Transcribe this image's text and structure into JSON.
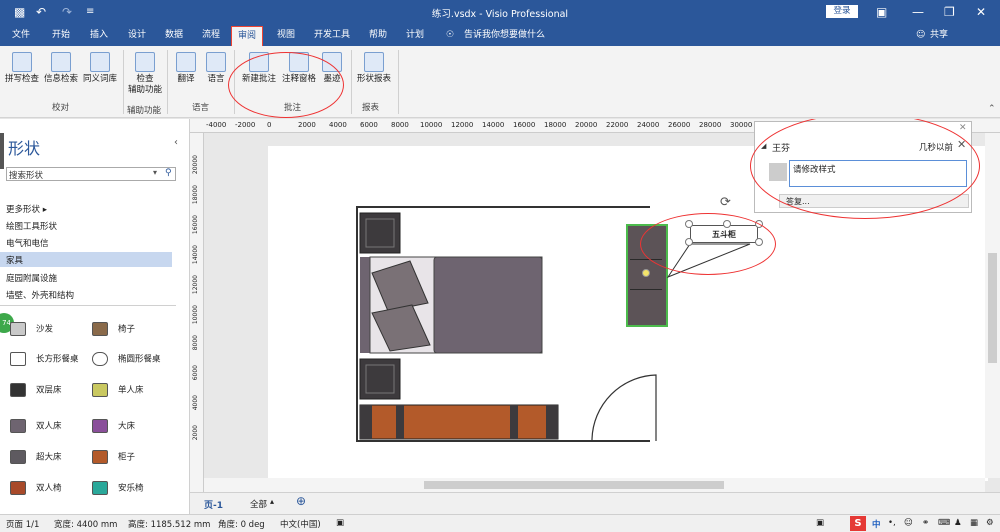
{
  "app": {
    "title": "练习.vsdx - Visio Professional",
    "login": "登录"
  },
  "menu": {
    "items": [
      "文件",
      "开始",
      "插入",
      "设计",
      "数据",
      "流程",
      "审阅",
      "视图",
      "开发工具",
      "帮助",
      "计划"
    ],
    "tell_me": "告诉我你想要做什么",
    "share": "共享"
  },
  "ribbon": {
    "proofing": {
      "spell": "拼写检查",
      "research": "信息检索",
      "thesaurus": "同义词库",
      "group": "校对"
    },
    "accessibility": {
      "check": "检查\n辅助功能",
      "group": "辅助功能"
    },
    "language": {
      "translate": "翻译",
      "lang": "语言",
      "group": "语言"
    },
    "comments": {
      "new": "新建批注",
      "pane": "注释窗格",
      "ink": "墨迹",
      "group": "批注"
    },
    "reports": {
      "shape_reports": "形状报表",
      "group": "报表"
    }
  },
  "shapes_panel": {
    "title": "形状",
    "search_placeholder": "搜索形状",
    "more": "更多形状",
    "categories": [
      "绘图工具形状",
      "电气和电信",
      "家具",
      "庭园附属设施",
      "墙壁、外壳和结构"
    ],
    "active_category": "家具",
    "badge": "74",
    "items": [
      "沙发",
      "椅子",
      "长方形餐桌",
      "椭圆形餐桌",
      "双层床",
      "单人床",
      "双人床",
      "大床",
      "超大床",
      "柜子",
      "双人椅",
      "安乐椅"
    ]
  },
  "ruler": {
    "h": [
      "-4000",
      "-2000",
      "0",
      "2000",
      "4000",
      "6000",
      "8000",
      "10000",
      "12000",
      "14000",
      "16000",
      "18000",
      "20000",
      "22000",
      "24000",
      "26000",
      "28000",
      "30000"
    ],
    "v": [
      "20000",
      "18000",
      "16000",
      "14000",
      "12000",
      "10000",
      "8000",
      "6000",
      "4000",
      "2000"
    ]
  },
  "drawing": {
    "callout_text": "五斗柜"
  },
  "comment": {
    "author": "王芬",
    "time": "几秒以前",
    "text": "请修改样式",
    "reply": "答复..."
  },
  "pagetabs": {
    "page": "页-1",
    "all": "全部"
  },
  "status": {
    "page": "页面 1/1",
    "width": "宽度: 4400 mm",
    "height": "高度: 1185.512 mm",
    "angle": "角度: 0 deg",
    "lang": "中文(中国)",
    "ime": "中"
  }
}
